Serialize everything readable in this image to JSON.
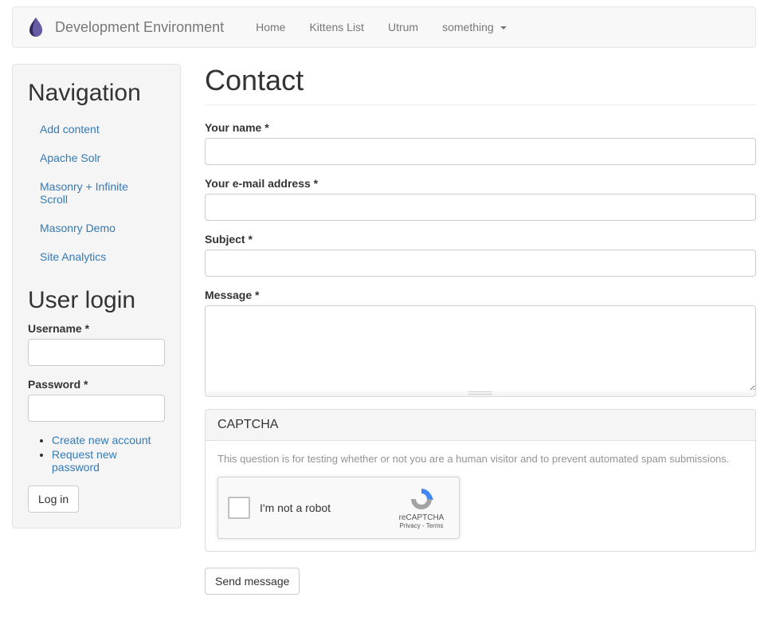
{
  "navbar": {
    "brand": "Development Environment",
    "items": [
      {
        "label": "Home"
      },
      {
        "label": "Kittens List"
      },
      {
        "label": "Utrum"
      },
      {
        "label": "something",
        "dropdown": true
      }
    ]
  },
  "sidebar": {
    "nav_heading": "Navigation",
    "nav_items": [
      {
        "label": "Add content"
      },
      {
        "label": "Apache Solr"
      },
      {
        "label": "Masonry + Infinite Scroll"
      },
      {
        "label": "Masonry Demo"
      },
      {
        "label": "Site Analytics"
      }
    ],
    "login": {
      "heading": "User login",
      "username_label": "Username *",
      "username_value": "",
      "password_label": "Password *",
      "password_value": "",
      "links": [
        {
          "label": "Create new account"
        },
        {
          "label": "Request new password"
        }
      ],
      "submit": "Log in"
    }
  },
  "main": {
    "title": "Contact",
    "form": {
      "name_label": "Your name *",
      "name_value": "",
      "email_label": "Your e-mail address *",
      "email_value": "",
      "subject_label": "Subject *",
      "subject_value": "",
      "message_label": "Message *",
      "message_value": "",
      "captcha": {
        "heading": "CAPTCHA",
        "help": "This question is for testing whether or not you are a human visitor and to prevent automated spam submissions.",
        "checkbox_label": "I'm not a robot",
        "brand": "reCAPTCHA",
        "links": "Privacy - Terms"
      },
      "submit": "Send message"
    }
  }
}
